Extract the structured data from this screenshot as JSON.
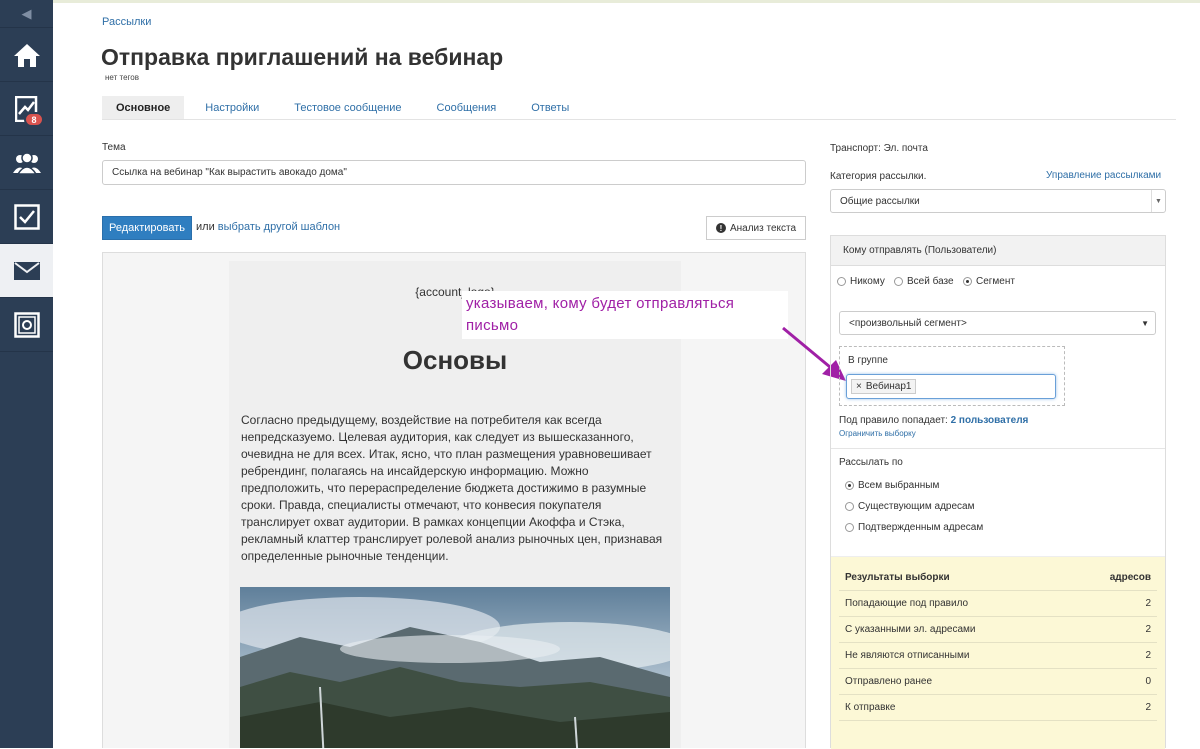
{
  "sidebar": {
    "badge_count": "8"
  },
  "breadcrumb": "Рассылки",
  "page_title": "Отправка приглашений на вебинар",
  "no_tags": "нет тегов",
  "tabs": [
    "Основное",
    "Настройки",
    "Тестовое сообщение",
    "Сообщения",
    "Ответы"
  ],
  "subject": {
    "label": "Тема",
    "value": "Ссылка на вебинар \"Как вырастить авокадо дома\""
  },
  "editor": {
    "edit_label": "Редактировать",
    "or_label": "или",
    "choose_template_label": "выбрать другой шаблон",
    "analyze_label": "Анализ текста"
  },
  "email_preview": {
    "logo_placeholder": "{account_logo}",
    "heading": "Основы",
    "body": "Согласно предыдущему, воздействие на потребителя как всегда непредсказуемо. Целевая аудитория, как следует из вышесказанного, очевидна не для всех. Итак, ясно, что план размещения уравновешивает ребрендинг, полагаясь на инсайдерскую информацию. Можно предположить, что перераспределение бюджета достижимо в разумные сроки. Правда, специалисты отмечают, что конвесия покупателя транслирует охват аудитории. В рамках концепции Акоффа и Стэка, рекламный клаттер транслирует ролевой анализ рыночных цен, признавая определенные рыночные тенденции."
  },
  "annotation": "указываем, кому будет отправляться письмо",
  "right": {
    "transport": "Транспорт: Эл. почта",
    "category_label": "Категория рассылки.",
    "manage_link": "Управление рассылками",
    "category_value": "Общие рассылки",
    "panel_title": "Кому отправлять (Пользователи)",
    "recipients": [
      "Никому",
      "Всей базе",
      "Сегмент"
    ],
    "recipients_selected": "Сегмент",
    "segment_value": "<произвольный сегмент>",
    "group_label": "В группе",
    "group_tag": "Вебинар1",
    "rule_prefix": "Под правило попадает:",
    "rule_count": "2 пользователя",
    "limit_link": "Ограничить выборку",
    "send_by_label": "Рассылать по",
    "send_by_options": [
      "Всем выбранным",
      "Существующим адресам",
      "Подтвержденным адресам"
    ],
    "send_by_selected": "Всем выбранным",
    "results_title": "Результаты выборки",
    "results_unit": "адресов",
    "results": [
      {
        "label": "Попадающие под правило",
        "value": "2"
      },
      {
        "label": "С указанными эл. адресами",
        "value": "2"
      },
      {
        "label": "Не являются отписанными",
        "value": "2"
      },
      {
        "label": "Отправлено ранее",
        "value": "0"
      },
      {
        "label": "К отправке",
        "value": "2"
      }
    ]
  },
  "colors": {
    "sidebar": "#2c3e55",
    "primary": "#2f7ec0",
    "link": "#2f6fa7",
    "annotation": "#a020a6",
    "results_bg": "#fcf8d6"
  }
}
